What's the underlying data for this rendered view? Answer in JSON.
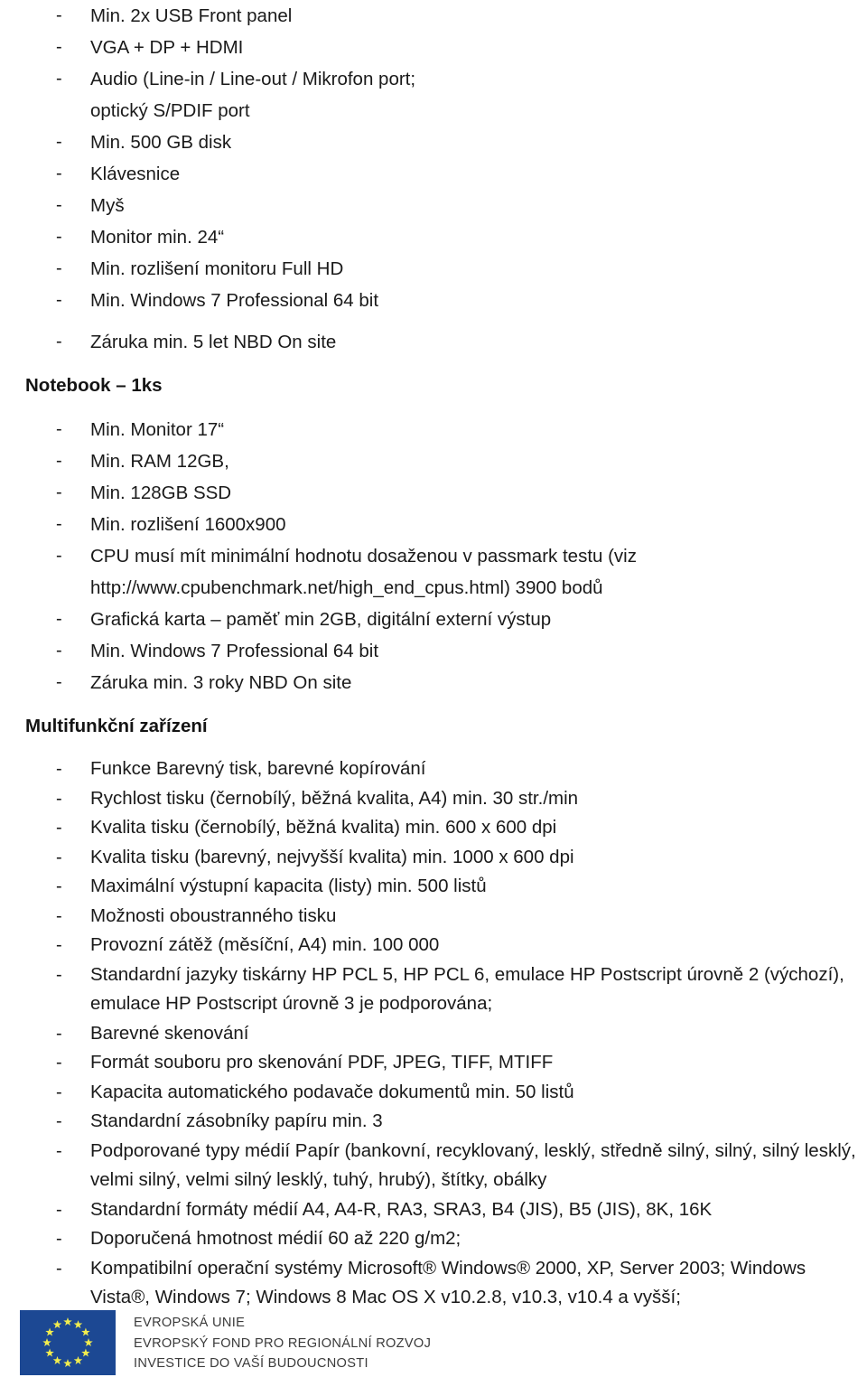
{
  "document": {
    "bullet_marker": "-",
    "sections": [
      {
        "id": "desktop-specs-continued",
        "heading": null,
        "spacing": "loose",
        "items": [
          {
            "text": "Min. 2x USB Front panel"
          },
          {
            "text": "VGA + DP + HDMI"
          },
          {
            "text": "Audio (Line-in / Line-out / Mikrofon port;\noptický S/PDIF port"
          },
          {
            "text": "Min. 500 GB disk"
          },
          {
            "text": "Klávesnice"
          },
          {
            "text": "Myš"
          },
          {
            "text": "Monitor min. 24“"
          },
          {
            "text": "Min. rozlišení monitoru Full HD"
          },
          {
            "text": "Min. Windows 7 Professional 64 bit"
          },
          {
            "text": "Záruka min. 5 let NBD On site",
            "gap_before": true
          }
        ]
      },
      {
        "id": "notebook",
        "heading": "Notebook – 1ks",
        "spacing": "loose",
        "items": [
          {
            "text": "Min. Monitor 17“"
          },
          {
            "text": "Min. RAM 12GB,"
          },
          {
            "text": "Min. 128GB SSD"
          },
          {
            "text": "Min. rozlišení 1600x900"
          },
          {
            "text": "CPU musí mít minimální hodnotu dosaženou v passmark testu (viz\nhttp://www.cpubenchmark.net/high_end_cpus.html) 3900 bodů"
          },
          {
            "text": "Grafická karta – paměť min 2GB, digitální externí výstup"
          },
          {
            "text": "Min. Windows 7 Professional 64 bit"
          },
          {
            "text": "Záruka min. 3 roky NBD On site"
          }
        ]
      },
      {
        "id": "multifunction-device",
        "heading": "Multifunkční zařízení",
        "spacing": "tight",
        "items": [
          {
            "text": "Funkce Barevný tisk, barevné kopírování"
          },
          {
            "text": "Rychlost tisku (černobílý, běžná kvalita, A4) min. 30 str./min"
          },
          {
            "text": "Kvalita tisku (černobílý, běžná kvalita) min. 600 x 600 dpi"
          },
          {
            "text": "Kvalita tisku (barevný, nejvyšší kvalita) min. 1000 x 600 dpi"
          },
          {
            "text": "Maximální výstupní kapacita (listy) min. 500 listů"
          },
          {
            "text": "Možnosti oboustranného tisku"
          },
          {
            "text": "Provozní zátěž (měsíční, A4) min. 100 000"
          },
          {
            "text": "Standardní jazyky tiskárny HP PCL 5, HP PCL 6, emulace HP Postscript úrovně 2 (výchozí),\nemulace HP Postscript úrovně 3 je podporována;"
          },
          {
            "text": "Barevné skenování"
          },
          {
            "text": "Formát souboru pro skenování PDF, JPEG, TIFF, MTIFF"
          },
          {
            "text": "Kapacita automatického podavače dokumentů min. 50 listů"
          },
          {
            "text": "Standardní zásobníky papíru min. 3"
          },
          {
            "text": "Podporované typy médií Papír (bankovní, recyklovaný, lesklý, středně silný, silný, silný lesklý,\nvelmi silný, velmi silný lesklý, tuhý, hrubý), štítky, obálky"
          },
          {
            "text": "Standardní formáty médií A4, A4-R, RA3, SRA3, B4 (JIS), B5 (JIS), 8K, 16K"
          },
          {
            "text": "Doporučená hmotnost médií 60 až 220 g/m2;"
          },
          {
            "text": "Kompatibilní operační systémy Microsoft® Windows® 2000, XP, Server 2003; Windows\nVista®, Windows 7; Windows 8 Mac OS X v10.2.8, v10.3, v10.4 a vyšší;"
          }
        ]
      }
    ]
  },
  "footer": {
    "flag_alt": "eu-flag",
    "flag_background": "#1c4893",
    "star_color": "#f2ed4e",
    "lines": [
      "EVROPSKÁ UNIE",
      "EVROPSKÝ FOND PRO REGIONÁLNÍ ROZVOJ",
      "INVESTICE DO VAŠÍ BUDOUCNOSTI"
    ]
  }
}
